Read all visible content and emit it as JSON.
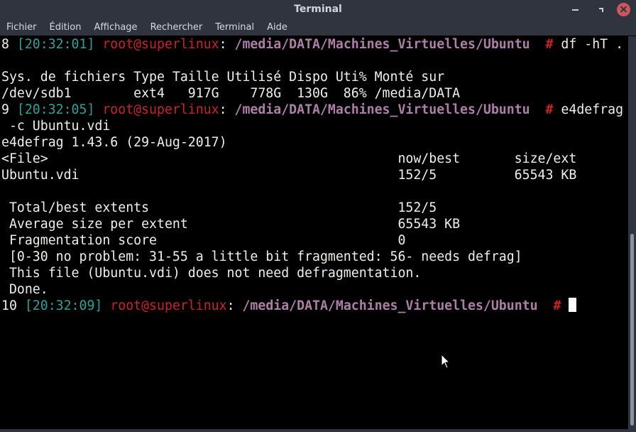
{
  "window": {
    "title": "Terminal"
  },
  "menubar": {
    "items": [
      "Fichier",
      "Édition",
      "Affichage",
      "Rechercher",
      "Terminal",
      "Aide"
    ]
  },
  "terminal": {
    "prompt1": {
      "num": "8",
      "time": "[20:32:01]",
      "user": "root@superlinux",
      "colon": ":",
      "path": "/media/DATA/Machines_Virtuelles/Ubuntu",
      "hash": "#",
      "cmd": "df -hT ."
    },
    "df_header": "Sys. de fichiers Type Taille Utilisé Dispo Uti% Monté sur",
    "df_row": "/dev/sdb1        ext4   917G    778G  130G  86% /media/DATA",
    "prompt2": {
      "num": "9",
      "time": "[20:32:05]",
      "user": "root@superlinux",
      "colon": ":",
      "path": "/media/DATA/Machines_Virtuelles/Ubuntu",
      "hash": "#",
      "cmd": "e4defrag"
    },
    "cmd_cont": " -c Ubuntu.vdi",
    "e4defrag_version": "e4defrag 1.43.6 (29-Aug-2017)",
    "table_header": "<File>                                             now/best       size/ext",
    "table_row": "Ubuntu.vdi                                         152/5          65543 KB",
    "stats": [
      " Total/best extents                                152/5",
      " Average size per extent                           65543 KB",
      " Fragmentation score                               0",
      " [0-30 no problem: 31-55 a little bit fragmented: 56- needs defrag]",
      " This file (Ubuntu.vdi) does not need defragmentation.",
      " Done."
    ],
    "prompt3": {
      "num": "10",
      "time": "[20:32:09]",
      "user": "root@superlinux",
      "colon": ":",
      "path": "/media/DATA/Machines_Virtuelles/Ubuntu",
      "hash": "#"
    }
  },
  "icons": {
    "minimize": "minimize-icon",
    "maximize": "maximize-icon",
    "close": "close-icon",
    "cursor": "mouse-pointer-icon"
  },
  "colors": {
    "titlebar_bg": "#2f343f",
    "terminal_bg": "#000000",
    "time": "#2aa198",
    "user": "#cc2222",
    "path": "#ad7fa8",
    "close_button": "#cc575d"
  }
}
